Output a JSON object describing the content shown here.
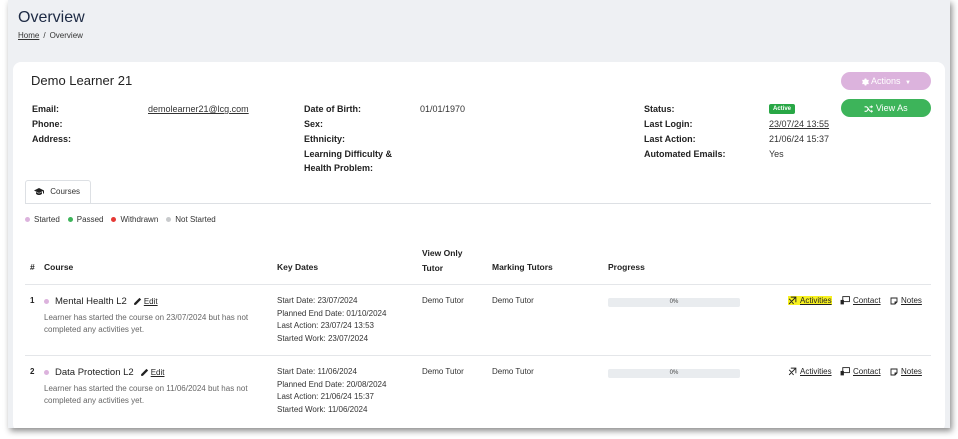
{
  "page": {
    "title": "Overview"
  },
  "breadcrumb": {
    "home": "Home",
    "separator": "/",
    "current": "Overview"
  },
  "learner": {
    "name": "Demo Learner 21",
    "email_label": "Email:",
    "email": "demolearner21@lcg.com",
    "phone_label": "Phone:",
    "address_label": "Address:",
    "dob_label": "Date of Birth:",
    "dob": "01/01/1970",
    "sex_label": "Sex:",
    "ethnicity_label": "Ethnicity:",
    "ldhp_label_1": "Learning Difficulty &",
    "ldhp_label_2": "Health Problem:",
    "status_label": "Status:",
    "status": "Active",
    "last_login_label": "Last Login:",
    "last_login": "23/07/24 13:55",
    "last_action_label": "Last Action:",
    "last_action": "21/06/24 15:37",
    "automated_emails_label": "Automated Emails:",
    "automated_emails": "Yes"
  },
  "buttons": {
    "actions": "Actions",
    "view_as": "View As"
  },
  "tabs": {
    "courses": "Courses"
  },
  "legend": {
    "started": "Started",
    "passed": "Passed",
    "withdrawn": "Withdrawn",
    "not_started": "Not Started"
  },
  "colors": {
    "started": "#dcb3dd",
    "passed": "#3db45a",
    "withdrawn": "#e53935",
    "not_started": "#c8cacc",
    "active_badge": "#28a745",
    "highlight": "#f7f11f"
  },
  "table": {
    "headers": {
      "num": "#",
      "course": "Course",
      "key_dates": "Key Dates",
      "view_only_1": "View Only",
      "view_only_2": "Tutor",
      "marking_tutors": "Marking Tutors",
      "progress": "Progress"
    },
    "rows": [
      {
        "num": "1",
        "course": "Mental Health L2",
        "edit": "Edit",
        "desc_1": "Learner has started the course on 23/07/2024 but has not",
        "desc_2": "completed any activities yet.",
        "start_date": "Start Date: 23/07/2024",
        "planned_end": "Planned End Date: 01/10/2024",
        "last_action": "Last Action: 23/07/24 13:53",
        "started_work": "Started Work: 23/07/2024",
        "view_only_tutor": "Demo Tutor",
        "marking_tutor": "Demo Tutor",
        "progress": "0%",
        "progress_value": 0,
        "activities": "Activities",
        "contact": "Contact",
        "notes": "Notes"
      },
      {
        "num": "2",
        "course": "Data Protection L2",
        "edit": "Edit",
        "desc_1": "Learner has started the course on 11/06/2024 but has not",
        "desc_2": "completed any activities yet.",
        "start_date": "Start Date: 11/06/2024",
        "planned_end": "Planned End Date: 20/08/2024",
        "last_action": "Last Action: 21/06/24 15:37",
        "started_work": "Started Work: 11/06/2024",
        "view_only_tutor": "Demo Tutor",
        "marking_tutor": "Demo Tutor",
        "progress": "0%",
        "progress_value": 0,
        "activities": "Activities",
        "contact": "Contact",
        "notes": "Notes"
      }
    ]
  }
}
